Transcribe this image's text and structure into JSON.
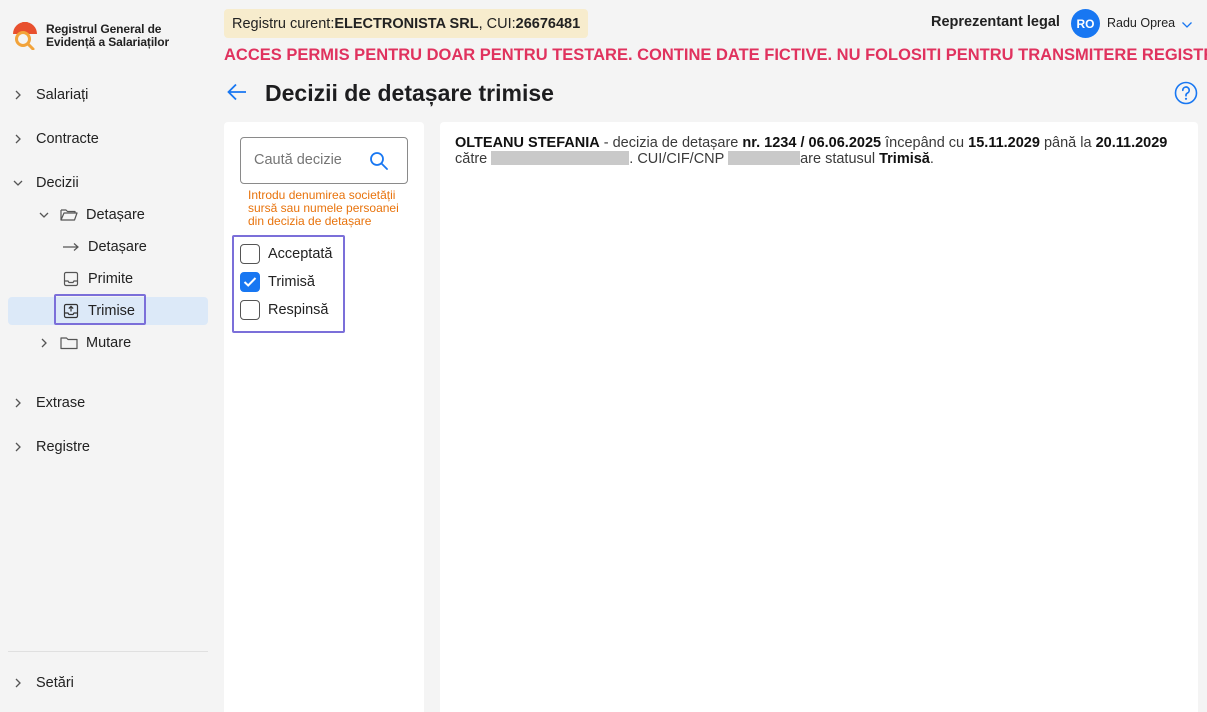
{
  "app": {
    "logo_line1": "Registrul General de",
    "logo_line2": "Evidență a Salariaților"
  },
  "sidebar": {
    "salariati": "Salariați",
    "contracte": "Contracte",
    "decizii": "Decizii",
    "detasare_group": "Detașare",
    "detasare": "Detașare",
    "primite": "Primite",
    "trimise": "Trimise",
    "mutare": "Mutare",
    "extrase": "Extrase",
    "registre": "Registre",
    "setari": "Setări"
  },
  "header": {
    "registry_prefix": "Registru curent: ",
    "company": "ELECTRONISTA SRL",
    "cui_prefix": ", CUI: ",
    "cui": "26676481",
    "role": "Reprezentant legal",
    "avatar_initials": "RO",
    "user_name": "Radu Oprea",
    "warning": "ACCES PERMIS PENTRU DOAR PENTRU TESTARE. CONTINE DATE FICTIVE. NU FOLOSITI PENTRU TRANSMITERE REGISTRU",
    "page_title": "Decizii de detașare trimise"
  },
  "filters": {
    "search_placeholder": "Caută decizie",
    "search_hint": "Introdu denumirea societății sursă sau numele persoanei din decizia de detașare",
    "statuses": [
      {
        "label": "Acceptată",
        "checked": false
      },
      {
        "label": "Trimisă",
        "checked": true
      },
      {
        "label": "Respinsă",
        "checked": false
      }
    ]
  },
  "decision": {
    "employee": "OLTEANU  STEFANIA",
    "text1": " - decizia de detașare ",
    "number": "nr. 1234 / 06.06.2025",
    "text2": " începând cu ",
    "start": "15.11.2029",
    "text3": " până la ",
    "end": "20.11.2029",
    "text4": " către ",
    "text5": ". CUI/CIF/CNP ",
    "text6": "are statusul ",
    "status": "Trimisă",
    "text7": "."
  },
  "colors": {
    "accent": "#1877f2",
    "warning": "#e0325e",
    "hint": "#e8730c",
    "badge_bg": "#f7eccd",
    "highlight_border": "#7b6fd9",
    "active_bg": "#dce9f8"
  }
}
